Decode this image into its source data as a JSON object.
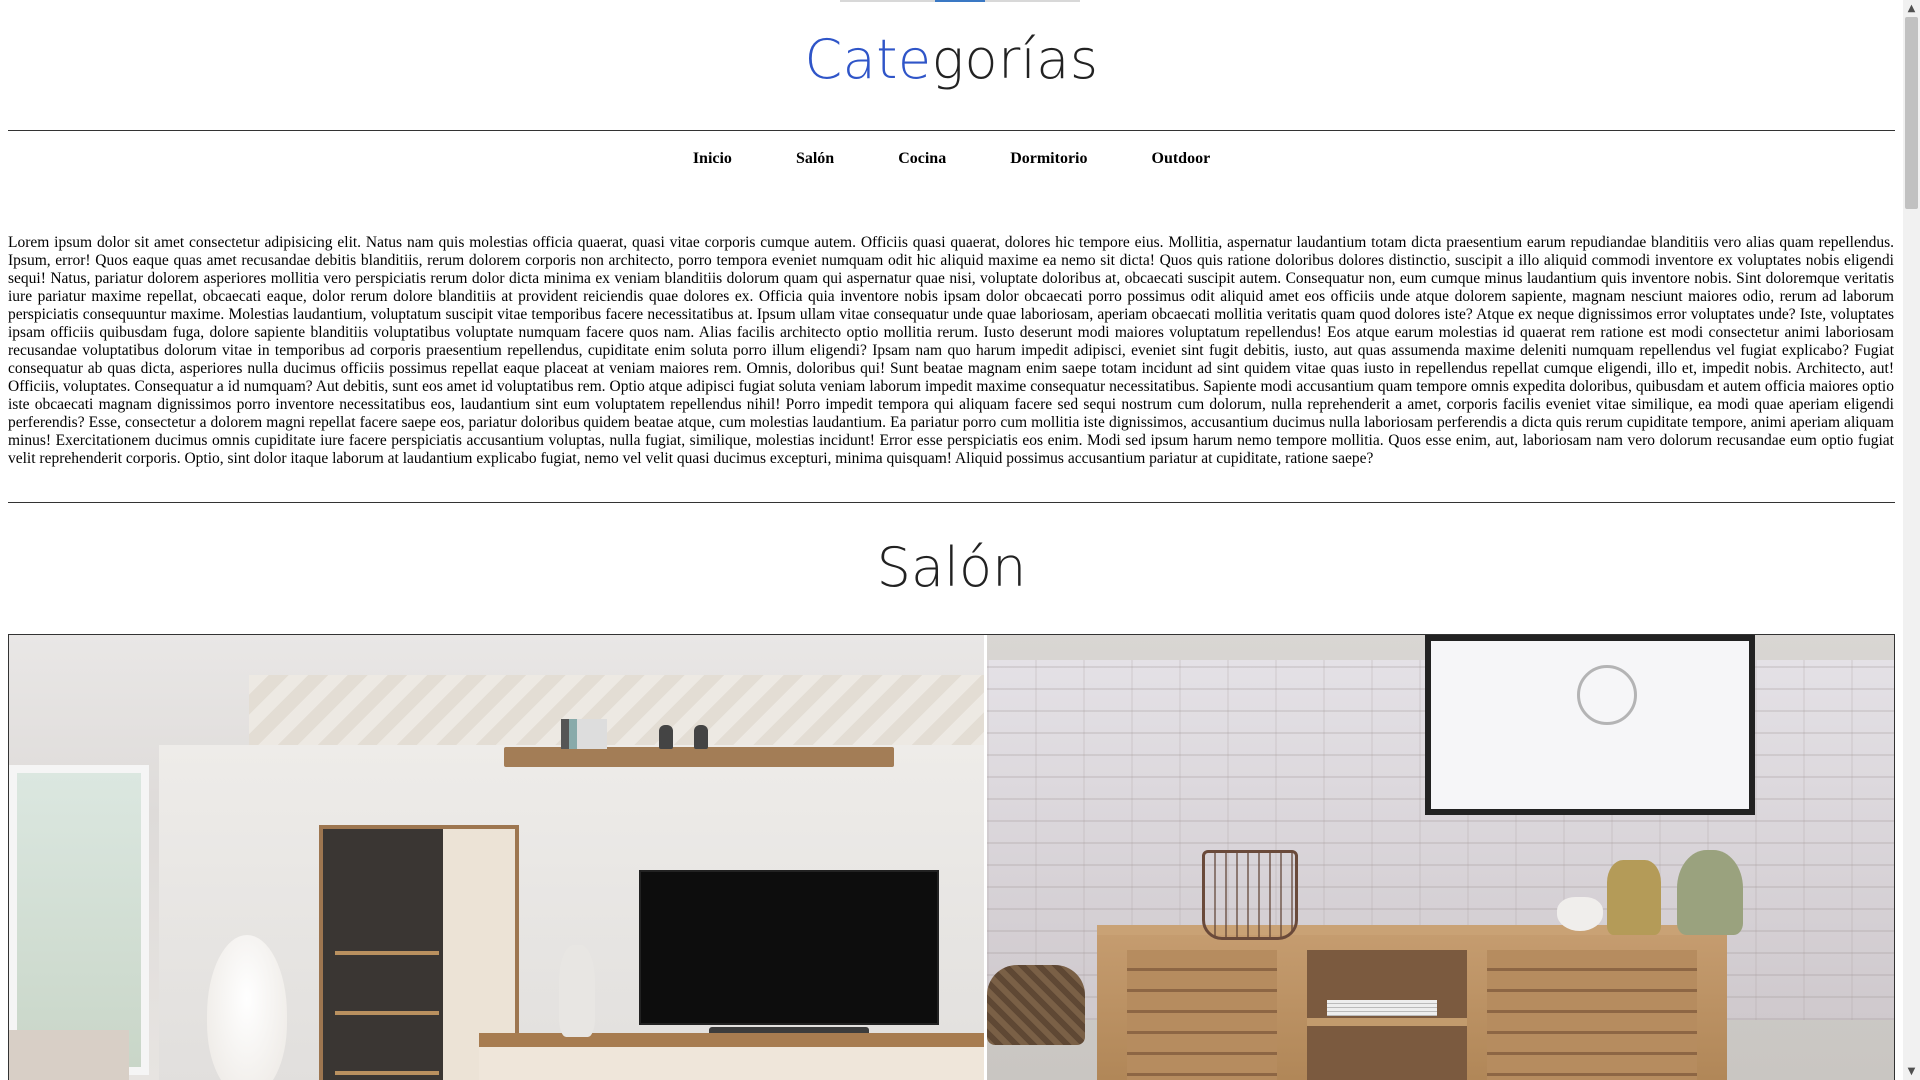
{
  "page": {
    "title_accent": "Cate",
    "title_rest": "gorías"
  },
  "nav": {
    "items": [
      {
        "label": "Inicio"
      },
      {
        "label": "Salón"
      },
      {
        "label": "Cocina"
      },
      {
        "label": "Dormitorio"
      },
      {
        "label": "Outdoor"
      }
    ]
  },
  "content": {
    "lorem": "Lorem ipsum dolor sit amet consectetur adipisicing elit. Natus nam quis molestias officia quaerat, quasi vitae corporis cumque autem. Officiis quasi quaerat, dolores hic tempore eius. Mollitia, aspernatur laudantium totam dicta praesentium earum repudiandae blanditiis vero alias quam repellendus. Ipsum, error! Quos eaque quas amet recusandae debitis blanditiis, rerum dolorem corporis non architecto, porro tempora eveniet numquam odit hic aliquid maxime ea nemo sit dicta! Quos quis ratione doloribus dolores distinctio, suscipit a illo aliquid commodi inventore ex voluptates nobis eligendi sequi! Natus, pariatur dolorem asperiores mollitia vero perspiciatis rerum dolor dicta minima ex veniam blanditiis dolorum quam qui aspernatur quae nisi, voluptate doloribus at, obcaecati suscipit autem. Consequatur non, eum cumque minus laudantium quis inventore nobis. Sint doloremque veritatis iure pariatur maxime repellat, obcaecati eaque, dolor rerum dolore blanditiis at provident reiciendis quae dolores ex. Officia quia inventore nobis ipsam dolor obcaecati porro possimus odit aliquid amet eos officiis unde atque dolorem sapiente, magnam nesciunt maiores odio, rerum ad laborum perspiciatis consequuntur maxime. Molestias laudantium, voluptatum suscipit vitae temporibus facere necessitatibus at. Ipsum ullam vitae consequatur unde quae laboriosam, aperiam obcaecati mollitia veritatis quam quod dolores iste? Atque ex neque dignissimos error voluptates unde? Iste, voluptates ipsam officiis quibusdam fuga, dolore sapiente blanditiis voluptatibus voluptate numquam facere quos nam. Alias facilis architecto optio mollitia rerum. Iusto deserunt modi maiores voluptatum repellendus! Eos atque earum molestias id quaerat rem ratione est modi consectetur animi laboriosam recusandae voluptatibus dolorum vitae in temporibus ad corporis praesentium repellendus, cupiditate enim soluta porro illum eligendi? Ipsam nam quo harum impedit adipisci, eveniet sint fugit debitis, iusto, aut quas assumenda maxime deleniti numquam repellendus vel fugiat explicabo? Fugiat consequatur ab quas dicta, asperiores nulla ducimus officiis possimus repellat eaque placeat at veniam maiores rem. Omnis, doloribus qui! Sunt beatae magnam enim saepe totam incidunt ad sint quidem vitae quas iusto in repellendus repellat cumque eligendi, illo et, impedit nobis. Architecto, aut! Officiis, voluptates. Consequatur a id numquam? Aut debitis, sunt eos amet id voluptatibus rem. Optio atque adipisci fugiat soluta veniam laborum impedit maxime consequatur necessitatibus. Sapiente modi accusantium quam tempore omnis expedita doloribus, quibusdam et autem officia maiores optio iste obcaecati magnam dignissimos porro inventore necessitatibus eos, laudantium sint eum voluptatem repellendus nihil! Porro impedit tempora qui aliquam facere sed sequi nostrum cum dolorum, nulla reprehenderit a amet, corporis facilis eveniet vitae similique, ea modi quae aperiam eligendi perferendis? Esse, consectetur a dolorem magni repellat facere saepe eos, pariatur doloribus quidem beatae atque, cum molestias laudantium. Ea pariatur porro cum mollitia iste dignissimos, accusantium ducimus nulla laboriosam perferendis a dicta quis rerum cupiditate tempore, animi aperiam aliquam minus! Exercitationem ducimus omnis cupiditate iure facere perspiciatis accusantium voluptas, nulla fugiat, similique, molestias incidunt! Error esse perspiciatis eos enim. Modi sed ipsum harum nemo tempore mollitia. Quos esse enim, aut, laboriosam nam vero dolorum recusandae eum optio fugiat velit reprehenderit corporis. Optio, sint dolor itaque laborum at laudantium explicabo fugiat, nemo vel velit quasi ducimus excepturi, minima quisquam! Aliquid possimus accusantium pariatur at cupiditate, ratione saepe?"
  },
  "section": {
    "title": "Salón"
  },
  "colors": {
    "title_accent": "#2f55c8",
    "slider_active": "#3a78c4"
  },
  "scrollbar": {
    "up_icon": "▲",
    "down_icon": "▼"
  }
}
